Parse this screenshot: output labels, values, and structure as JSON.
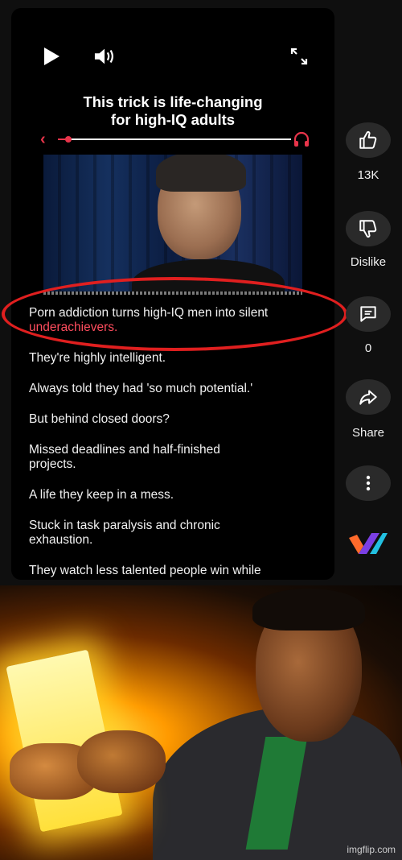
{
  "video": {
    "title": "This trick is life-changing\nfor high-IQ adults",
    "subtitle_lines": [
      {
        "a": "Porn addiction turns high-IQ men into silent",
        "b": "underachievers."
      },
      {
        "a": "They're highly intelligent."
      },
      {
        "a": "Always told they had 'so much potential.'"
      },
      {
        "a": "But behind closed doors?"
      },
      {
        "a": "Missed deadlines and half-finished",
        "b": "projects."
      },
      {
        "a": "A life they keep in a mess."
      },
      {
        "a": "Stuck in task paralysis and chronic",
        "b": "exhaustion."
      },
      {
        "a": "They watch less talented people win while"
      }
    ],
    "controls": {
      "play": "play-icon",
      "volume": "volume-icon",
      "fullscreen": "fullscreen-icon",
      "back": "‹",
      "audio": "headphones-icon"
    }
  },
  "actions": {
    "like": {
      "label": "13K",
      "icon": "thumbs-up-icon"
    },
    "dislike": {
      "label": "Dislike",
      "icon": "thumbs-down-icon"
    },
    "comments": {
      "label": "0",
      "icon": "comment-icon"
    },
    "share": {
      "label": "Share",
      "icon": "share-icon"
    },
    "more": {
      "icon": "more-vertical-icon"
    }
  },
  "colors": {
    "accent": "#e8344a",
    "annotation": "#e01f1f",
    "bg": "#0f0f0f"
  },
  "watermark": "imgflip.com"
}
